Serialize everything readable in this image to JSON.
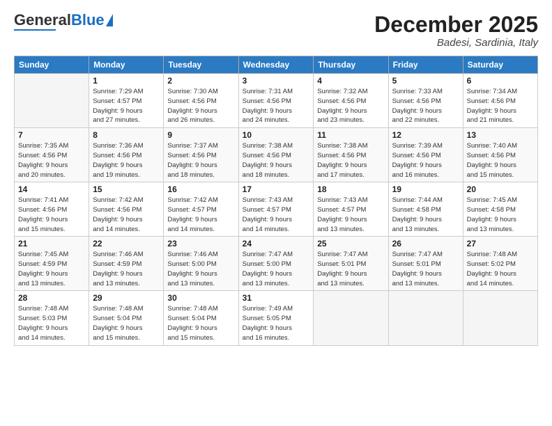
{
  "logo": {
    "general": "General",
    "blue": "Blue"
  },
  "header": {
    "month": "December 2025",
    "location": "Badesi, Sardinia, Italy"
  },
  "days_of_week": [
    "Sunday",
    "Monday",
    "Tuesday",
    "Wednesday",
    "Thursday",
    "Friday",
    "Saturday"
  ],
  "weeks": [
    [
      {
        "num": "",
        "info": ""
      },
      {
        "num": "1",
        "info": "Sunrise: 7:29 AM\nSunset: 4:57 PM\nDaylight: 9 hours\nand 27 minutes."
      },
      {
        "num": "2",
        "info": "Sunrise: 7:30 AM\nSunset: 4:56 PM\nDaylight: 9 hours\nand 26 minutes."
      },
      {
        "num": "3",
        "info": "Sunrise: 7:31 AM\nSunset: 4:56 PM\nDaylight: 9 hours\nand 24 minutes."
      },
      {
        "num": "4",
        "info": "Sunrise: 7:32 AM\nSunset: 4:56 PM\nDaylight: 9 hours\nand 23 minutes."
      },
      {
        "num": "5",
        "info": "Sunrise: 7:33 AM\nSunset: 4:56 PM\nDaylight: 9 hours\nand 22 minutes."
      },
      {
        "num": "6",
        "info": "Sunrise: 7:34 AM\nSunset: 4:56 PM\nDaylight: 9 hours\nand 21 minutes."
      }
    ],
    [
      {
        "num": "7",
        "info": "Sunrise: 7:35 AM\nSunset: 4:56 PM\nDaylight: 9 hours\nand 20 minutes."
      },
      {
        "num": "8",
        "info": "Sunrise: 7:36 AM\nSunset: 4:56 PM\nDaylight: 9 hours\nand 19 minutes."
      },
      {
        "num": "9",
        "info": "Sunrise: 7:37 AM\nSunset: 4:56 PM\nDaylight: 9 hours\nand 18 minutes."
      },
      {
        "num": "10",
        "info": "Sunrise: 7:38 AM\nSunset: 4:56 PM\nDaylight: 9 hours\nand 18 minutes."
      },
      {
        "num": "11",
        "info": "Sunrise: 7:38 AM\nSunset: 4:56 PM\nDaylight: 9 hours\nand 17 minutes."
      },
      {
        "num": "12",
        "info": "Sunrise: 7:39 AM\nSunset: 4:56 PM\nDaylight: 9 hours\nand 16 minutes."
      },
      {
        "num": "13",
        "info": "Sunrise: 7:40 AM\nSunset: 4:56 PM\nDaylight: 9 hours\nand 15 minutes."
      }
    ],
    [
      {
        "num": "14",
        "info": "Sunrise: 7:41 AM\nSunset: 4:56 PM\nDaylight: 9 hours\nand 15 minutes."
      },
      {
        "num": "15",
        "info": "Sunrise: 7:42 AM\nSunset: 4:56 PM\nDaylight: 9 hours\nand 14 minutes."
      },
      {
        "num": "16",
        "info": "Sunrise: 7:42 AM\nSunset: 4:57 PM\nDaylight: 9 hours\nand 14 minutes."
      },
      {
        "num": "17",
        "info": "Sunrise: 7:43 AM\nSunset: 4:57 PM\nDaylight: 9 hours\nand 14 minutes."
      },
      {
        "num": "18",
        "info": "Sunrise: 7:43 AM\nSunset: 4:57 PM\nDaylight: 9 hours\nand 13 minutes."
      },
      {
        "num": "19",
        "info": "Sunrise: 7:44 AM\nSunset: 4:58 PM\nDaylight: 9 hours\nand 13 minutes."
      },
      {
        "num": "20",
        "info": "Sunrise: 7:45 AM\nSunset: 4:58 PM\nDaylight: 9 hours\nand 13 minutes."
      }
    ],
    [
      {
        "num": "21",
        "info": "Sunrise: 7:45 AM\nSunset: 4:59 PM\nDaylight: 9 hours\nand 13 minutes."
      },
      {
        "num": "22",
        "info": "Sunrise: 7:46 AM\nSunset: 4:59 PM\nDaylight: 9 hours\nand 13 minutes."
      },
      {
        "num": "23",
        "info": "Sunrise: 7:46 AM\nSunset: 5:00 PM\nDaylight: 9 hours\nand 13 minutes."
      },
      {
        "num": "24",
        "info": "Sunrise: 7:47 AM\nSunset: 5:00 PM\nDaylight: 9 hours\nand 13 minutes."
      },
      {
        "num": "25",
        "info": "Sunrise: 7:47 AM\nSunset: 5:01 PM\nDaylight: 9 hours\nand 13 minutes."
      },
      {
        "num": "26",
        "info": "Sunrise: 7:47 AM\nSunset: 5:01 PM\nDaylight: 9 hours\nand 13 minutes."
      },
      {
        "num": "27",
        "info": "Sunrise: 7:48 AM\nSunset: 5:02 PM\nDaylight: 9 hours\nand 14 minutes."
      }
    ],
    [
      {
        "num": "28",
        "info": "Sunrise: 7:48 AM\nSunset: 5:03 PM\nDaylight: 9 hours\nand 14 minutes."
      },
      {
        "num": "29",
        "info": "Sunrise: 7:48 AM\nSunset: 5:04 PM\nDaylight: 9 hours\nand 15 minutes."
      },
      {
        "num": "30",
        "info": "Sunrise: 7:48 AM\nSunset: 5:04 PM\nDaylight: 9 hours\nand 15 minutes."
      },
      {
        "num": "31",
        "info": "Sunrise: 7:49 AM\nSunset: 5:05 PM\nDaylight: 9 hours\nand 16 minutes."
      },
      {
        "num": "",
        "info": ""
      },
      {
        "num": "",
        "info": ""
      },
      {
        "num": "",
        "info": ""
      }
    ]
  ]
}
